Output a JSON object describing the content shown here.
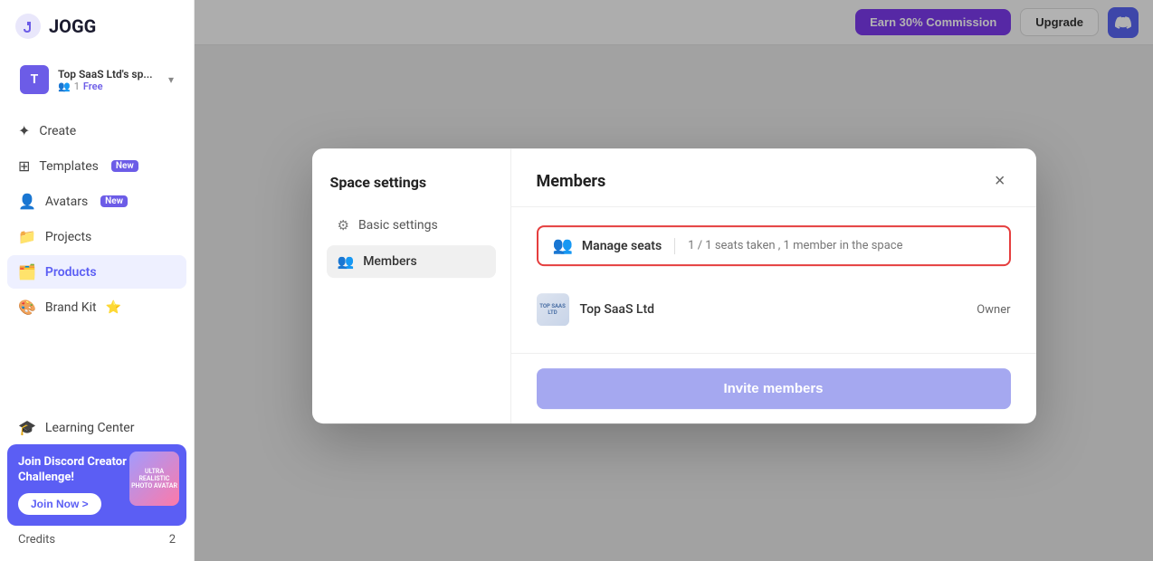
{
  "sidebar": {
    "logo_text": "JOGG",
    "workspace": {
      "avatar_letter": "T",
      "name": "Top SaaS Ltd's sp...",
      "members_count": "1",
      "plan": "Free"
    },
    "nav_items": [
      {
        "id": "create",
        "label": "Create",
        "icon": "✦"
      },
      {
        "id": "templates",
        "label": "Templates",
        "icon": "⊞",
        "badge": "New"
      },
      {
        "id": "avatars",
        "label": "Avatars",
        "icon": "👤",
        "badge": "New"
      },
      {
        "id": "projects",
        "label": "Projects",
        "icon": "📁"
      },
      {
        "id": "products",
        "label": "Products",
        "icon": "🗂️",
        "active": true
      },
      {
        "id": "brand-kit",
        "label": "Brand Kit",
        "icon": "🎨",
        "extra": "⭐"
      }
    ],
    "bottom": {
      "discord_title": "Join Discord Creator Challenge!",
      "discord_subtitle": "",
      "join_label": "Join Now >",
      "thumb_text": "ULTRA REALISTIC PHOTO AVATAR",
      "learning_label": "Learning Center",
      "credits_label": "Credits",
      "credits_count": "2"
    }
  },
  "topbar": {
    "earn_label": "Earn 30% Commission",
    "upgrade_label": "Upgrade"
  },
  "modal": {
    "sidebar_title": "Space settings",
    "sidebar_items": [
      {
        "id": "basic-settings",
        "label": "Basic settings",
        "icon": "⚙"
      },
      {
        "id": "members",
        "label": "Members",
        "icon": "👥",
        "active": true
      }
    ],
    "title": "Members",
    "close_icon": "×",
    "manage_seats": {
      "label": "Manage seats",
      "seats_info": "1 / 1 seats taken ,  1 member in the space"
    },
    "members_list": [
      {
        "name": "Top SaaS Ltd",
        "role": "Owner",
        "avatar_text": "TOP SAAS LTD"
      }
    ],
    "invite_button_label": "Invite members"
  }
}
